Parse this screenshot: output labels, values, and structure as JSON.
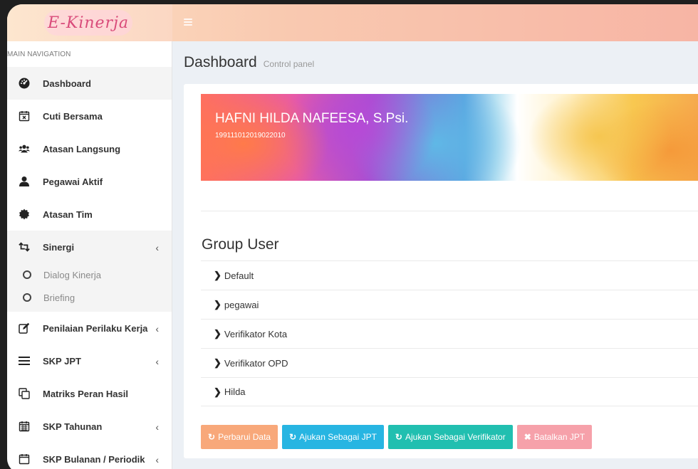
{
  "header": {
    "logo_text": "E-Kinerja"
  },
  "sidebar": {
    "header": "MAIN NAVIGATION",
    "items": [
      {
        "label": "Dashboard",
        "icon": "dashboard-icon"
      },
      {
        "label": "Cuti Bersama",
        "icon": "calendar-x-icon"
      },
      {
        "label": "Atasan Langsung",
        "icon": "users-icon"
      },
      {
        "label": "Pegawai Aktif",
        "icon": "user-icon"
      },
      {
        "label": "Atasan Tim",
        "icon": "certificate-icon"
      },
      {
        "label": "Sinergi",
        "icon": "retweet-icon",
        "chevron": "‹"
      },
      {
        "label": "Penilaian Perilaku Kerja",
        "icon": "edit-icon",
        "chevron": "‹"
      },
      {
        "label": "SKP JPT",
        "icon": "bars-icon",
        "chevron": "‹"
      },
      {
        "label": "Matriks Peran Hasil",
        "icon": "clone-icon"
      },
      {
        "label": "SKP Tahunan",
        "icon": "calendar-icon",
        "chevron": "‹"
      },
      {
        "label": "SKP Bulanan / Periodik",
        "icon": "calendar-icon",
        "chevron": "‹"
      }
    ],
    "subitems": [
      {
        "label": "Dialog Kinerja"
      },
      {
        "label": "Briefing"
      }
    ]
  },
  "content": {
    "title": "Dashboard",
    "subtitle": "Control panel",
    "profile": {
      "name": "HAFNI HILDA NAFEESA, S.Psi.",
      "nip": "199111012019022010"
    },
    "group_title": "Group User",
    "groups": [
      "Default",
      "pegawai",
      "Verifikator Kota",
      "Verifikator OPD",
      "Hilda"
    ],
    "buttons": [
      {
        "label": "Perbarui Data",
        "icon": "refresh-icon"
      },
      {
        "label": "Ajukan Sebagai JPT",
        "icon": "refresh-icon"
      },
      {
        "label": "Ajukan Sebagai Verifikator",
        "icon": "refresh-icon"
      },
      {
        "label": "Batalkan JPT",
        "icon": "times-icon"
      }
    ]
  },
  "colors": {
    "active_bg": "#f4f4f4",
    "btn_orange": "#f8a87a",
    "btn_cyan": "#27b5e2",
    "btn_teal": "#21bfb0",
    "btn_pink": "#f6a1aa"
  }
}
